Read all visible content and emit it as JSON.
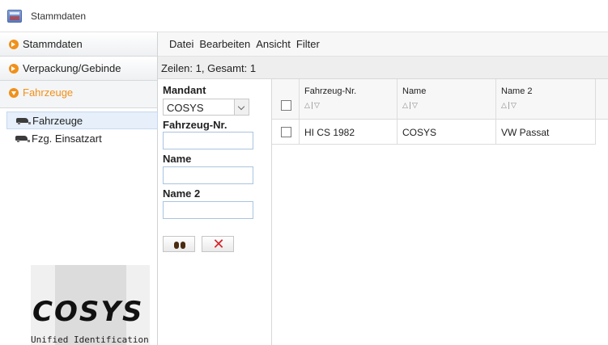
{
  "window": {
    "title": "Stammdaten"
  },
  "sidebar": {
    "sections": [
      {
        "label": "Stammdaten"
      },
      {
        "label": "Verpackung/Gebinde"
      },
      {
        "label": "Fahrzeuge"
      }
    ],
    "tree_items": [
      {
        "label": "Fahrzeuge",
        "icon": "car-icon"
      },
      {
        "label": "Fzg. Einsatzart",
        "icon": "car-icon"
      }
    ],
    "logo": {
      "text": "COSYS",
      "subtitle": "Unified Identification"
    }
  },
  "menu": {
    "items": [
      "Datei",
      "Bearbeiten",
      "Ansicht",
      "Filter"
    ]
  },
  "status": {
    "row_count": "Zeilen: 1, Gesamt: 1"
  },
  "filter": {
    "mandant_label": "Mandant",
    "mandant_value": "COSYS",
    "fahrzeug_nr_label": "Fahrzeug-Nr.",
    "fahrzeug_nr_value": "",
    "name_label": "Name",
    "name_value": "",
    "name2_label": "Name 2",
    "name2_value": "",
    "search_icon": "binoculars-icon",
    "clear_icon": "red-x-icon"
  },
  "grid": {
    "columns": [
      "Fahrzeug-Nr.",
      "Name",
      "Name 2"
    ],
    "sort_glyph": "△|▽",
    "rows": [
      {
        "fahrzeug_nr": "HI CS 1982",
        "name": "COSYS",
        "name2": "VW Passat"
      }
    ]
  },
  "colors": {
    "accent": "#f0901a",
    "selection": "#e6effa",
    "clear_button": "#d8222a"
  }
}
